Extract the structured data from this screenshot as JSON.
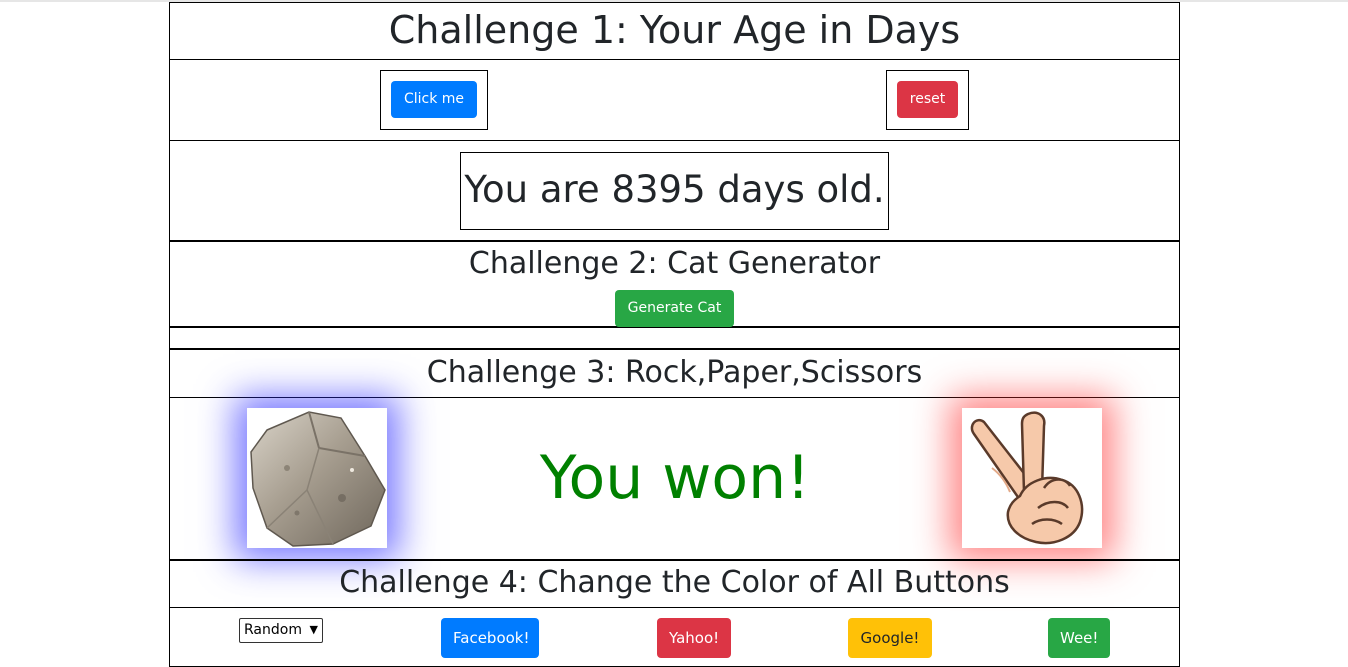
{
  "challenge1": {
    "title": "Challenge 1: Your Age in Days",
    "click_label": "Click me",
    "reset_label": "reset",
    "result_text": "You are 8395 days old."
  },
  "challenge2": {
    "title": "Challenge 2: Cat Generator",
    "generate_label": "Generate Cat"
  },
  "challenge3": {
    "title": "Challenge 3: Rock,Paper,Scissors",
    "result_text": "You won!",
    "result_color": "#008000",
    "player_choice": "rock",
    "bot_choice": "scissors",
    "player_glow": "#3333ff",
    "bot_glow": "#ff3333"
  },
  "challenge4": {
    "title": "Challenge 4: Change the Color of All Buttons",
    "select_value": "Random",
    "buttons": [
      "Facebook!",
      "Yahoo!",
      "Google!",
      "Wee!"
    ]
  },
  "colors": {
    "primary": "#007bff",
    "danger": "#dc3545",
    "success": "#28a745",
    "warning": "#ffc107"
  }
}
